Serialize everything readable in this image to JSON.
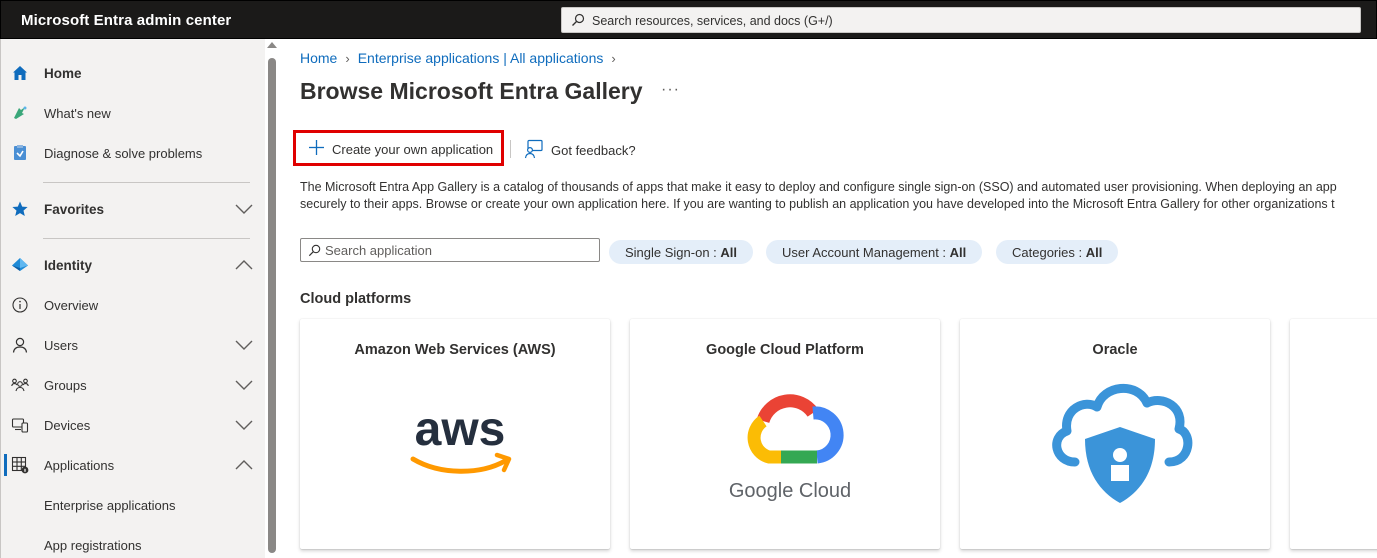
{
  "header": {
    "app_title": "Microsoft Entra admin center",
    "search_placeholder": "Search resources, services, and docs (G+/)"
  },
  "sidebar": {
    "items": [
      {
        "label": "Home",
        "icon": "home-icon"
      },
      {
        "label": "What's new",
        "icon": "whats-new-icon"
      },
      {
        "label": "Diagnose & solve problems",
        "icon": "diagnose-icon"
      },
      {
        "label": "Favorites",
        "icon": "star-icon"
      },
      {
        "label": "Identity",
        "icon": "identity-icon"
      },
      {
        "label": "Overview",
        "icon": "info-icon"
      },
      {
        "label": "Users",
        "icon": "user-icon"
      },
      {
        "label": "Groups",
        "icon": "groups-icon"
      },
      {
        "label": "Devices",
        "icon": "devices-icon"
      },
      {
        "label": "Applications",
        "icon": "applications-icon"
      },
      {
        "label": "Enterprise applications"
      },
      {
        "label": "App registrations"
      }
    ]
  },
  "breadcrumb": {
    "items": [
      "Home",
      "Enterprise applications | All applications"
    ]
  },
  "page": {
    "title": "Browse Microsoft Entra Gallery",
    "more": "···"
  },
  "commands": {
    "create": "Create your own application",
    "feedback": "Got feedback?"
  },
  "description": {
    "line1": "The Microsoft Entra App Gallery is a catalog of thousands of apps that make it easy to deploy and configure single sign-on (SSO) and automated user provisioning. When deploying an app",
    "line2": "securely to their apps. Browse or create your own application here. If you are wanting to publish an application you have developed into the Microsoft Entra Gallery for other organizations t"
  },
  "filters": {
    "search_placeholder": "Search application",
    "pills": [
      {
        "name": "Single Sign-on",
        "value": "All"
      },
      {
        "name": "User Account Management",
        "value": "All"
      },
      {
        "name": "Categories",
        "value": "All"
      }
    ]
  },
  "section": {
    "title": "Cloud platforms"
  },
  "cards": [
    {
      "title": "Amazon Web Services (AWS)",
      "logo_text": "aws"
    },
    {
      "title": "Google Cloud Platform",
      "logo_text": "Google Cloud"
    },
    {
      "title": "Oracle"
    }
  ],
  "colors": {
    "accent": "#0f6cbd",
    "highlight_border": "#e00000",
    "topbar": "#1b1a19"
  }
}
